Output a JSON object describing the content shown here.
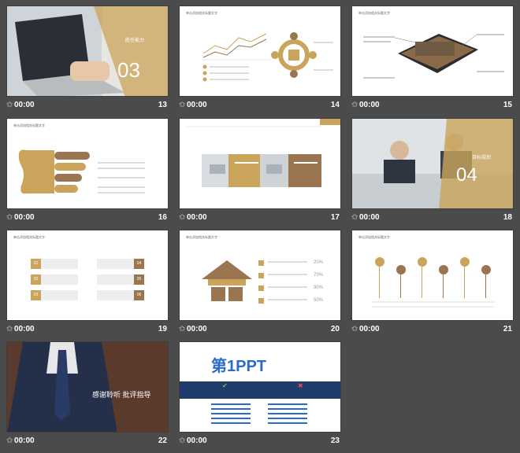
{
  "slides": [
    {
      "num": "13",
      "time": "00:00",
      "big": "03",
      "sub": "胜任能力",
      "kind": "photo-laptop"
    },
    {
      "num": "14",
      "time": "00:00",
      "title": "单击添加相关标题文字",
      "kind": "chart-cycle"
    },
    {
      "num": "15",
      "time": "00:00",
      "title": "单击添加相关标题文字",
      "kind": "phone"
    },
    {
      "num": "16",
      "time": "00:00",
      "title": "单击添加相关标题文字",
      "kind": "puzzle"
    },
    {
      "num": "17",
      "time": "00:00",
      "title": "",
      "kind": "photos"
    },
    {
      "num": "18",
      "time": "00:00",
      "big": "04",
      "sub": "目标规划",
      "kind": "photo-handshake"
    },
    {
      "num": "19",
      "time": "00:00",
      "title": "单击添加相关标题文字",
      "kind": "numbered",
      "labels": [
        "01",
        "02",
        "03",
        "04",
        "05",
        "06"
      ]
    },
    {
      "num": "20",
      "time": "00:00",
      "title": "单击添加相关标题文字",
      "kind": "house",
      "percents": [
        "20%",
        "70%",
        "90%",
        "50%"
      ]
    },
    {
      "num": "21",
      "time": "00:00",
      "title": "单击添加相关标题文字",
      "kind": "pins"
    },
    {
      "num": "22",
      "time": "00:00",
      "caption": "感谢聆听 批评指导",
      "kind": "photo-suit"
    },
    {
      "num": "23",
      "time": "00:00",
      "logo": "第1PPT",
      "kind": "promo"
    }
  ],
  "colors": {
    "background": "#4b4b4b",
    "tan": "#c9a45a",
    "brown": "#9a7550"
  },
  "icons": {
    "star": "star-icon"
  }
}
